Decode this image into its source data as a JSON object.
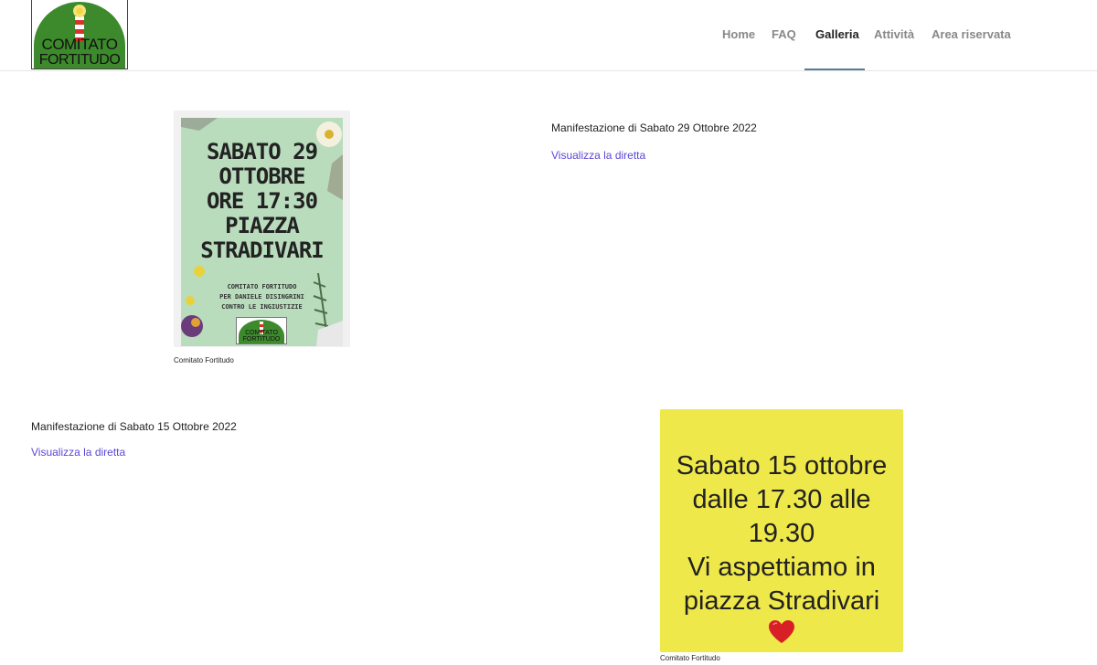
{
  "header": {
    "logo": {
      "line1": "COMITATO",
      "line2": "FORTITUDO"
    },
    "nav": [
      {
        "label": "Home",
        "active": false
      },
      {
        "label": "FAQ",
        "active": false
      },
      {
        "label": "Galleria",
        "active": true
      },
      {
        "label": "Attività",
        "active": false
      },
      {
        "label": "Area riservata",
        "active": false
      }
    ]
  },
  "gallery": [
    {
      "poster": {
        "lines": [
          "SABATO 29",
          "OTTOBRE",
          "ORE 17:30",
          "PIAZZA",
          "STRADIVARI"
        ],
        "small_lines": [
          "COMITATO FORTITUDO",
          "PER DANIELE DISINGRINI",
          "CONTRO LE INGIUSTIZIE"
        ],
        "logo_line1": "COMITATO",
        "logo_line2": "FORTITUDO"
      },
      "caption": "Comitato Fortitudo",
      "title": "Manifestazione di Sabato 29 Ottobre 2022",
      "link": "Visualizza la diretta"
    },
    {
      "poster": {
        "lines": [
          "Sabato 15 ottobre",
          "dalle 17.30 alle",
          "19.30",
          "Vi aspettiamo in",
          "piazza Stradivari"
        ],
        "heart": "heart-icon"
      },
      "caption": "Comitato Fortitudo",
      "title": "Manifestazione di Sabato 15 Ottobre 2022",
      "link": "Visualizza la diretta"
    }
  ],
  "colors": {
    "link": "#5b48d6",
    "nav_inactive": "#888888",
    "nav_active": "#222222",
    "logo_green": "#3d8a2c",
    "poster1_bg": "#b9dcbd",
    "poster2_bg": "#efe84a",
    "heart": "#d81f26"
  }
}
